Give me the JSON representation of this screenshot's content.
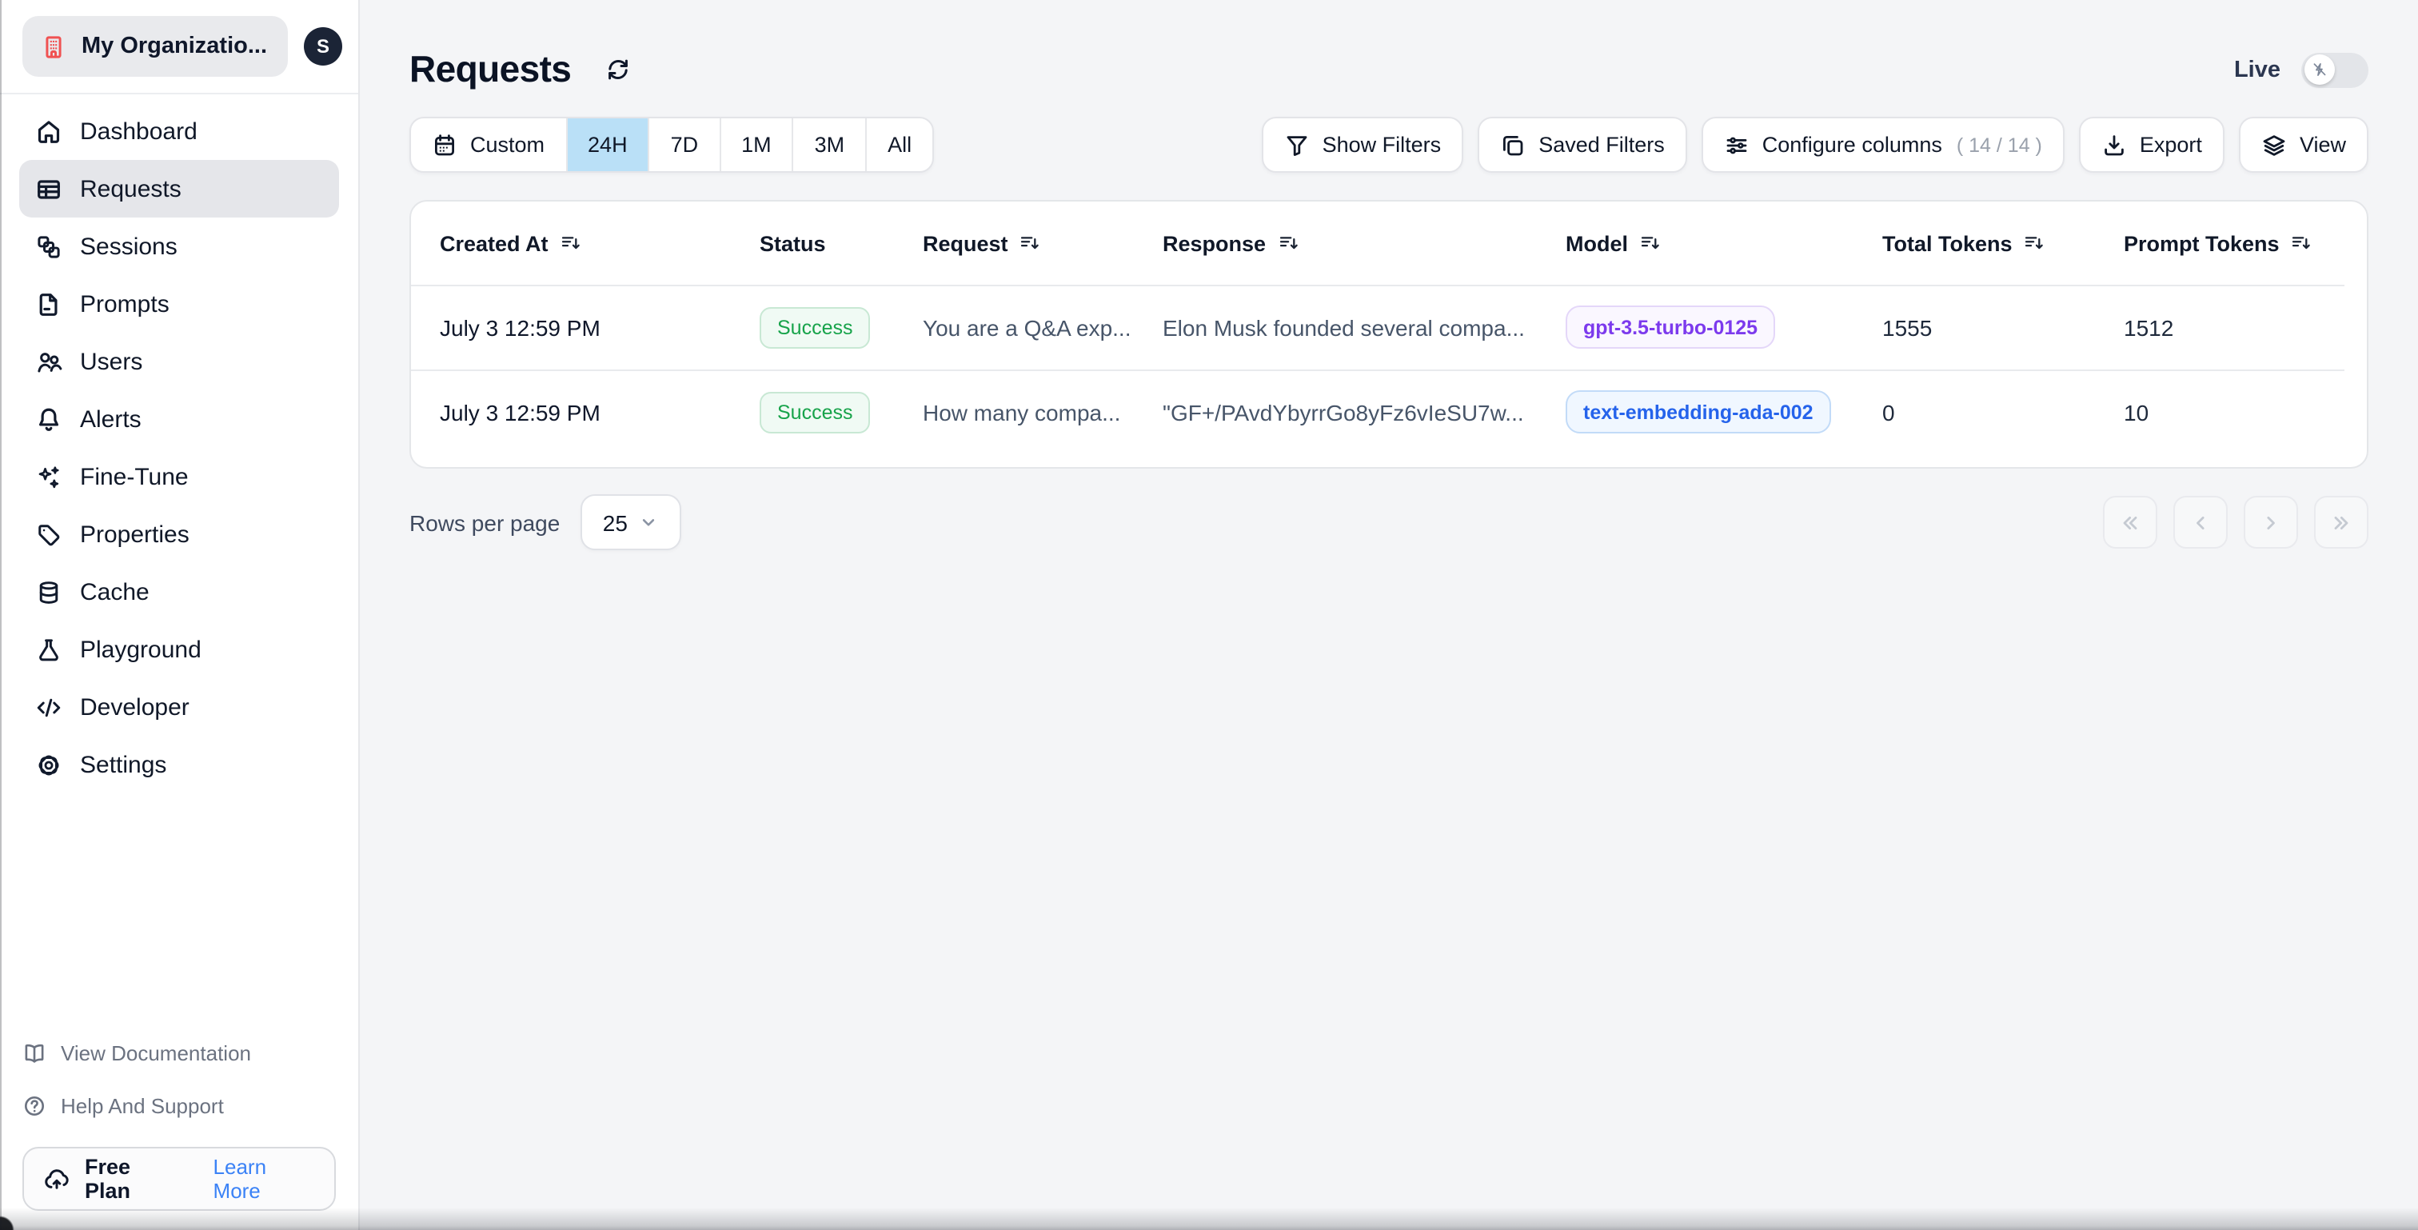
{
  "colors": {
    "selected_range_bg": "#bae0f7",
    "success_badge_text": "#17a34a",
    "model_gpt_badge_text": "#7c3aed",
    "model_embedding_badge_text": "#2563eb",
    "learn_more_link": "#3b82f6",
    "org_icon": "#f05252",
    "avatar_bg": "#1b2436",
    "sidebar_active_bg": "#e5e6ea"
  },
  "sidebar": {
    "org": {
      "name": "My Organizatio...",
      "avatar_initial": "S"
    },
    "nav": [
      {
        "label": "Dashboard",
        "icon": "home-icon",
        "active": false
      },
      {
        "label": "Requests",
        "icon": "table-icon",
        "active": true
      },
      {
        "label": "Sessions",
        "icon": "sessions-icon",
        "active": false
      },
      {
        "label": "Prompts",
        "icon": "document-icon",
        "active": false
      },
      {
        "label": "Users",
        "icon": "users-icon",
        "active": false
      },
      {
        "label": "Alerts",
        "icon": "bell-icon",
        "active": false
      },
      {
        "label": "Fine-Tune",
        "icon": "sparkles-icon",
        "active": false
      },
      {
        "label": "Properties",
        "icon": "tag-icon",
        "active": false
      },
      {
        "label": "Cache",
        "icon": "database-icon",
        "active": false
      },
      {
        "label": "Playground",
        "icon": "flask-icon",
        "active": false
      },
      {
        "label": "Developer",
        "icon": "code-icon",
        "active": false
      },
      {
        "label": "Settings",
        "icon": "gear-icon",
        "active": false
      }
    ],
    "footer_links": [
      {
        "label": "View Documentation",
        "icon": "book-open-icon"
      },
      {
        "label": "Help And Support",
        "icon": "question-circle-icon"
      }
    ],
    "plan": {
      "label": "Free Plan",
      "cta": "Learn More",
      "icon": "cloud-upload-icon"
    }
  },
  "header": {
    "title": "Requests",
    "live_label": "Live",
    "live_enabled": false
  },
  "toolbar": {
    "time_ranges": [
      {
        "label": "Custom",
        "icon": "calendar-icon",
        "selected": false
      },
      {
        "label": "24H",
        "selected": true
      },
      {
        "label": "7D",
        "selected": false
      },
      {
        "label": "1M",
        "selected": false
      },
      {
        "label": "3M",
        "selected": false
      },
      {
        "label": "All",
        "selected": false
      }
    ],
    "show_filters": "Show Filters",
    "saved_filters": "Saved Filters",
    "configure_columns": "Configure columns",
    "configure_columns_count": "( 14 / 14 )",
    "export": "Export",
    "view": "View"
  },
  "table": {
    "columns": [
      {
        "label": "Created At",
        "sortable": true
      },
      {
        "label": "Status",
        "sortable": false
      },
      {
        "label": "Request",
        "sortable": true
      },
      {
        "label": "Response",
        "sortable": true
      },
      {
        "label": "Model",
        "sortable": true
      },
      {
        "label": "Total Tokens",
        "sortable": true
      },
      {
        "label": "Prompt Tokens",
        "sortable": true
      }
    ],
    "rows": [
      {
        "created_at": "July 3 12:59 PM",
        "status": "Success",
        "request": "You are a Q&A exp...",
        "response": "Elon Musk founded several compa...",
        "model": "gpt-3.5-turbo-0125",
        "total_tokens": "1555",
        "prompt_tokens": "1512"
      },
      {
        "created_at": "July 3 12:59 PM",
        "status": "Success",
        "request": "How many compa...",
        "response": "\"GF+/PAvdYbyrrGo8yFz6vIeSU7w...",
        "model": "text-embedding-ada-002",
        "total_tokens": "0",
        "prompt_tokens": "10"
      }
    ]
  },
  "pagination": {
    "rows_per_page_label": "Rows per page",
    "rows_per_page_value": "25"
  }
}
